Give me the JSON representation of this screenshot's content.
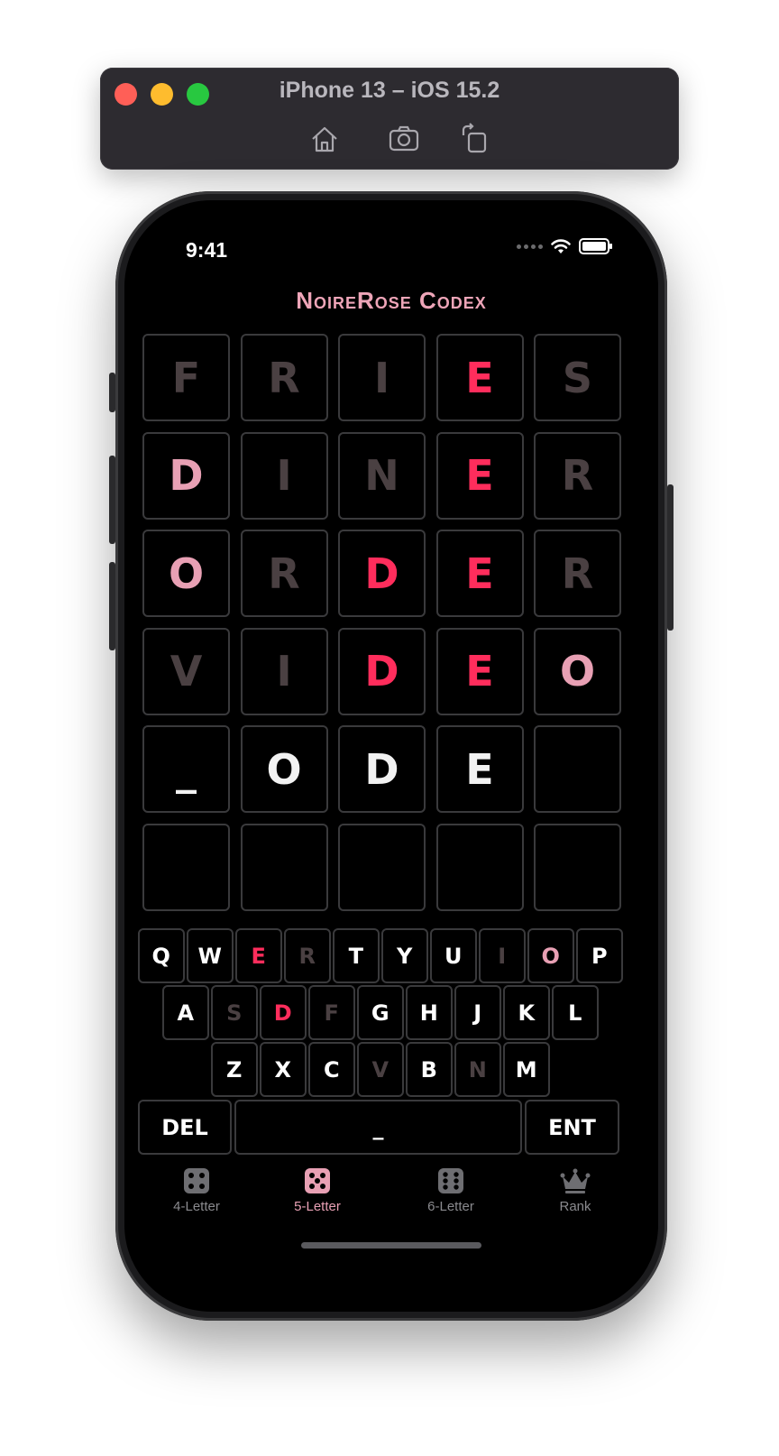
{
  "simulator": {
    "title": "iPhone 13 – iOS 15.2",
    "buttons": [
      "home-icon",
      "screenshot-icon",
      "rotate-icon"
    ]
  },
  "status_bar": {
    "time": "9:41"
  },
  "app": {
    "title": "NoireRose Codex"
  },
  "board": {
    "rows": [
      [
        {
          "letter": "F",
          "state": "absent"
        },
        {
          "letter": "R",
          "state": "absent"
        },
        {
          "letter": "I",
          "state": "absent"
        },
        {
          "letter": "E",
          "state": "correct"
        },
        {
          "letter": "S",
          "state": "absent"
        }
      ],
      [
        {
          "letter": "D",
          "state": "present"
        },
        {
          "letter": "I",
          "state": "absent"
        },
        {
          "letter": "N",
          "state": "absent"
        },
        {
          "letter": "E",
          "state": "correct"
        },
        {
          "letter": "R",
          "state": "absent"
        }
      ],
      [
        {
          "letter": "O",
          "state": "present"
        },
        {
          "letter": "R",
          "state": "absent"
        },
        {
          "letter": "D",
          "state": "correct"
        },
        {
          "letter": "E",
          "state": "correct"
        },
        {
          "letter": "R",
          "state": "absent"
        }
      ],
      [
        {
          "letter": "V",
          "state": "absent"
        },
        {
          "letter": "I",
          "state": "absent"
        },
        {
          "letter": "D",
          "state": "correct"
        },
        {
          "letter": "E",
          "state": "correct"
        },
        {
          "letter": "O",
          "state": "present"
        }
      ],
      [
        {
          "letter": "_",
          "state": "typed"
        },
        {
          "letter": "O",
          "state": "typed"
        },
        {
          "letter": "D",
          "state": "typed"
        },
        {
          "letter": "E",
          "state": "typed"
        },
        {
          "letter": "",
          "state": "empty"
        }
      ],
      [
        {
          "letter": "",
          "state": "empty"
        },
        {
          "letter": "",
          "state": "empty"
        },
        {
          "letter": "",
          "state": "empty"
        },
        {
          "letter": "",
          "state": "empty"
        },
        {
          "letter": "",
          "state": "empty"
        }
      ]
    ]
  },
  "keyboard": {
    "row1": [
      {
        "k": "Q",
        "s": "unused"
      },
      {
        "k": "W",
        "s": "unused"
      },
      {
        "k": "E",
        "s": "correct"
      },
      {
        "k": "R",
        "s": "absent"
      },
      {
        "k": "T",
        "s": "unused"
      },
      {
        "k": "Y",
        "s": "unused"
      },
      {
        "k": "U",
        "s": "unused"
      },
      {
        "k": "I",
        "s": "absent"
      },
      {
        "k": "O",
        "s": "present"
      },
      {
        "k": "P",
        "s": "unused"
      }
    ],
    "row2": [
      {
        "k": "A",
        "s": "unused"
      },
      {
        "k": "S",
        "s": "absent"
      },
      {
        "k": "D",
        "s": "correct"
      },
      {
        "k": "F",
        "s": "absent"
      },
      {
        "k": "G",
        "s": "unused"
      },
      {
        "k": "H",
        "s": "unused"
      },
      {
        "k": "J",
        "s": "unused"
      },
      {
        "k": "K",
        "s": "unused"
      },
      {
        "k": "L",
        "s": "unused"
      }
    ],
    "row3": [
      {
        "k": "Z",
        "s": "unused"
      },
      {
        "k": "X",
        "s": "unused"
      },
      {
        "k": "C",
        "s": "unused"
      },
      {
        "k": "V",
        "s": "absent"
      },
      {
        "k": "B",
        "s": "unused"
      },
      {
        "k": "N",
        "s": "absent"
      },
      {
        "k": "M",
        "s": "unused"
      }
    ],
    "delete_label": "DEL",
    "space_label": "_",
    "enter_label": "ENT"
  },
  "tabs": [
    {
      "label": "4-Letter",
      "icon": "dice-four-icon",
      "active": false
    },
    {
      "label": "5-Letter",
      "icon": "dice-five-icon",
      "active": true
    },
    {
      "label": "6-Letter",
      "icon": "dice-six-icon",
      "active": false
    },
    {
      "label": "Rank",
      "icon": "crown-icon",
      "active": false
    }
  ],
  "colors": {
    "correct": "#ff2d5c",
    "present": "#e8a0b4",
    "absent": "#4a4042",
    "accent": "#e8a0b4"
  }
}
